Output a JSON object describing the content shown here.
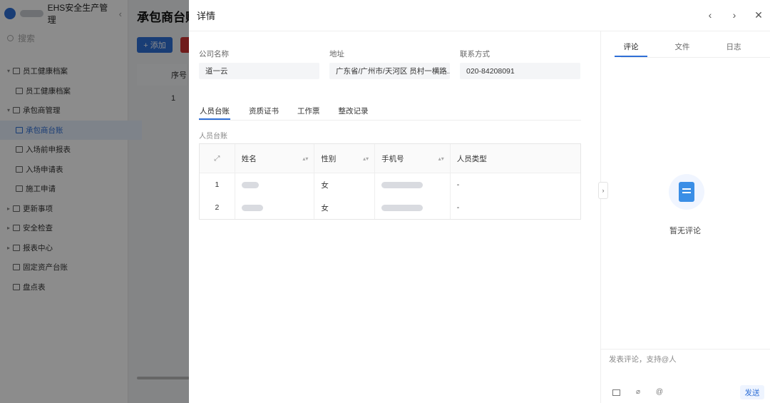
{
  "app": {
    "name": "EHS安全生产管理",
    "search_placeholder": "搜索",
    "collapse_glyph": "‹"
  },
  "sidebar": {
    "items": [
      {
        "label": "员工健康档案",
        "level": 1,
        "expanded": true
      },
      {
        "label": "员工健康档案",
        "level": 2
      },
      {
        "label": "承包商管理",
        "level": 1,
        "expanded": true
      },
      {
        "label": "承包商台账",
        "level": 2,
        "active": true
      },
      {
        "label": "入场前申报表",
        "level": 2
      },
      {
        "label": "入场申请表",
        "level": 2
      },
      {
        "label": "施工申请",
        "level": 2
      },
      {
        "label": "更新事项",
        "level": 1
      },
      {
        "label": "安全检查",
        "level": 1
      },
      {
        "label": "报表中心",
        "level": 1
      },
      {
        "label": "固定资产台账",
        "level": 1
      },
      {
        "label": "盘点表",
        "level": 1
      }
    ]
  },
  "background_page": {
    "title": "承包商台账",
    "add_button": "+ 添加",
    "table_header_seq": "序号",
    "row1_seq": "1"
  },
  "drawer": {
    "title": "详情",
    "icons": {
      "prev": "chevron-left-icon",
      "next": "chevron-right-icon",
      "close": "close-icon"
    },
    "glyphs": {
      "prev": "‹",
      "next": "›",
      "close": "✕",
      "expand": "⤢",
      "sort": "▴▾",
      "pane_toggle": "›"
    },
    "fields": [
      {
        "label": "公司名称",
        "value": "道一云"
      },
      {
        "label": "地址",
        "value": "广东省/广州市/天河区 员村一横路..."
      },
      {
        "label": "联系方式",
        "value": "020-84208091"
      }
    ],
    "tabs": [
      {
        "label": "人员台账",
        "active": true
      },
      {
        "label": "资质证书"
      },
      {
        "label": "工作票"
      },
      {
        "label": "整改记录"
      }
    ],
    "section_label": "人员台账",
    "table": {
      "columns": [
        "姓名",
        "性别",
        "手机号",
        "人员类型"
      ],
      "rows": [
        {
          "index": "1",
          "gender": "女",
          "type": "-"
        },
        {
          "index": "2",
          "gender": "女",
          "type": "-"
        }
      ]
    },
    "side": {
      "tabs": [
        {
          "label": "评论",
          "active": true
        },
        {
          "label": "文件"
        },
        {
          "label": "日志"
        }
      ],
      "empty_text": "暂无评论",
      "comment_placeholder": "发表评论，支持@人",
      "at_glyph": "@",
      "attach_glyph": "⌀",
      "send_label": "发送"
    }
  },
  "colors": {
    "accent": "#2f6fd6",
    "overlay": "rgba(0,0,0,0.45)",
    "empty_icon": "#3a8ee6"
  }
}
